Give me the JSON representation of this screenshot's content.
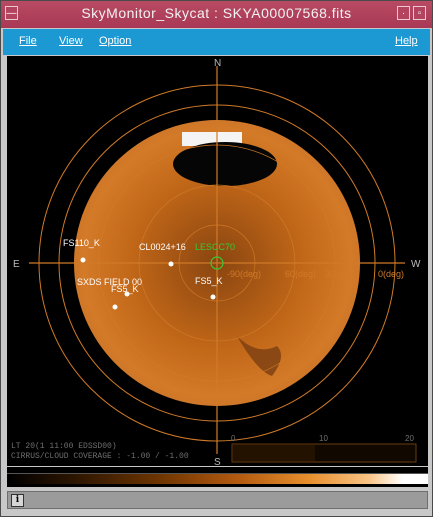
{
  "window": {
    "title": "SkyMonitor_Skycat : SKYA00007568.fits"
  },
  "menu": {
    "file": "File",
    "view": "View",
    "options": "Option",
    "help": "Help"
  },
  "compass": {
    "north": "N",
    "south": "S",
    "east": "E",
    "west": "W"
  },
  "targets": [
    {
      "label": "FS110_K"
    },
    {
      "label": "CL0024+16"
    },
    {
      "label": "LESCC70"
    },
    {
      "label": "SXDS FIELD 00"
    },
    {
      "label": "FS5_K"
    },
    {
      "label": "FS5_K"
    }
  ],
  "scale_labels": {
    "a": "-90(deg)",
    "b": "60(deg)",
    "c": "30(deg)",
    "d": "0(deg)"
  },
  "overlay": {
    "line1": "LT 20(1 11:00 EDSSD00)",
    "line2": "CIRRUS/CLOUD COVERAGE : -1.00 / -1.00",
    "scale_left": "0",
    "scale_mid": "10",
    "scale_right": "20"
  },
  "colors": {
    "sky": "#c66a1c",
    "ring": "#d07a28",
    "marker": "#ffffff",
    "target_text": "#ffffff",
    "highlight_text": "#33cc33"
  },
  "status": {
    "message": ""
  }
}
